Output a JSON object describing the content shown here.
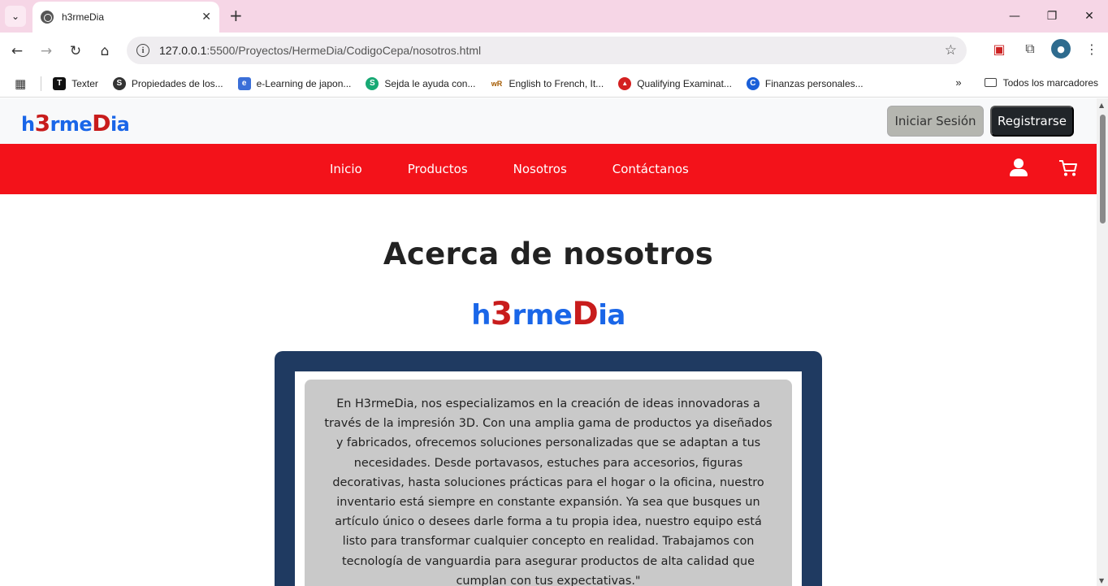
{
  "browser": {
    "tab_title": "h3rmeDia",
    "url_host": "127.0.0.1",
    "url_rest": ":5500/Proyectos/HermeDia/CodigoCepa/nosotros.html",
    "bookmarks": [
      {
        "label": "Texter",
        "icon_bg": "#111",
        "icon_char": "T"
      },
      {
        "label": "Propiedades de los...",
        "icon_bg": "#333",
        "icon_char": "S"
      },
      {
        "label": "e-Learning de japon...",
        "icon_bg": "#3b6fd8",
        "icon_char": "e"
      },
      {
        "label": "Sejda le ayuda con...",
        "icon_bg": "#18a974",
        "icon_char": "S"
      },
      {
        "label": "English to French, It...",
        "icon_bg": "#ffffff",
        "icon_char": "wR"
      },
      {
        "label": "Qualifying Examinat...",
        "icon_bg": "#d42020",
        "icon_char": "▲"
      },
      {
        "label": "Finanzas personales...",
        "icon_bg": "#1a5fd8",
        "icon_char": "C"
      }
    ],
    "all_bookmarks_label": "Todos los marcadores"
  },
  "site": {
    "logo": {
      "p1": "h",
      "p2": "3",
      "p3": "rme",
      "p4": "D",
      "p5": "ia"
    },
    "login_label": "Iniciar Sesión",
    "register_label": "Registrarse",
    "nav": [
      "Inicio",
      "Productos",
      "Nosotros",
      "Contáctanos"
    ]
  },
  "main": {
    "title": "Acerca de nosotros",
    "about_text": "En H3rmeDia, nos especializamos en la creación de ideas innovadoras a través de la impresión 3D. Con una amplia gama de productos ya diseñados y fabricados, ofrecemos soluciones personalizadas que se adaptan a tus necesidades. Desde portavasos, estuches para accesorios, figuras decorativas, hasta soluciones prácticas para el hogar o la oficina, nuestro inventario está siempre en constante expansión. Ya sea que busques un artículo único o desees darle forma a tu propia idea, nuestro equipo está listo para transformar cualquier concepto en realidad. Trabajamos con tecnología de vanguardia para asegurar productos de alta calidad que cumplan con tus expectativas.\""
  },
  "colors": {
    "nav_bg": "#f3121a",
    "frame_bg": "#1f3a61",
    "card_bg": "#c9c9c9",
    "logo_blue": "#1a66e8",
    "logo_red": "#c81c1c"
  }
}
